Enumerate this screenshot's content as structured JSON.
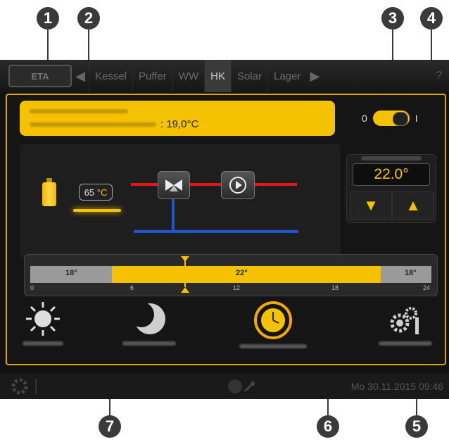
{
  "callouts": [
    "1",
    "2",
    "3",
    "4",
    "5",
    "6",
    "7"
  ],
  "logo": "ETA",
  "tabs": [
    {
      "label": "Kessel",
      "active": false
    },
    {
      "label": "Puffer",
      "active": false
    },
    {
      "label": "WW",
      "active": false
    },
    {
      "label": "HK",
      "active": true
    },
    {
      "label": "Solar",
      "active": false
    },
    {
      "label": "Lager",
      "active": false
    }
  ],
  "info": {
    "temperature": ": 19,0°C"
  },
  "switch": {
    "off_label": "0",
    "on_label": "I",
    "state": "on"
  },
  "heating_circuit": {
    "buffer_temp_value": "65",
    "buffer_temp_unit": "°C"
  },
  "setpoint": {
    "value": "22.0°"
  },
  "timeline": {
    "segments": [
      {
        "from": 0,
        "to": 6.5,
        "temp": "18°"
      },
      {
        "from": 6.5,
        "to": 22.5,
        "temp": "22°"
      },
      {
        "from": 22.5,
        "to": 24,
        "temp": "18°"
      }
    ],
    "hour_labels": [
      "0",
      "6",
      "12",
      "18",
      "24"
    ]
  },
  "modes": [
    {
      "icon": "sun-icon"
    },
    {
      "icon": "moon-icon"
    },
    {
      "icon": "timer-clock-icon"
    },
    {
      "icon": "settings-gears-icon"
    }
  ],
  "status": {
    "datetime": "Mo 30.11.2015 09:46"
  },
  "colors": {
    "accent": "#f5c200",
    "screen_bg": "#111111",
    "supply_pipe": "#e0191c",
    "return_pipe": "#1f56d0"
  }
}
